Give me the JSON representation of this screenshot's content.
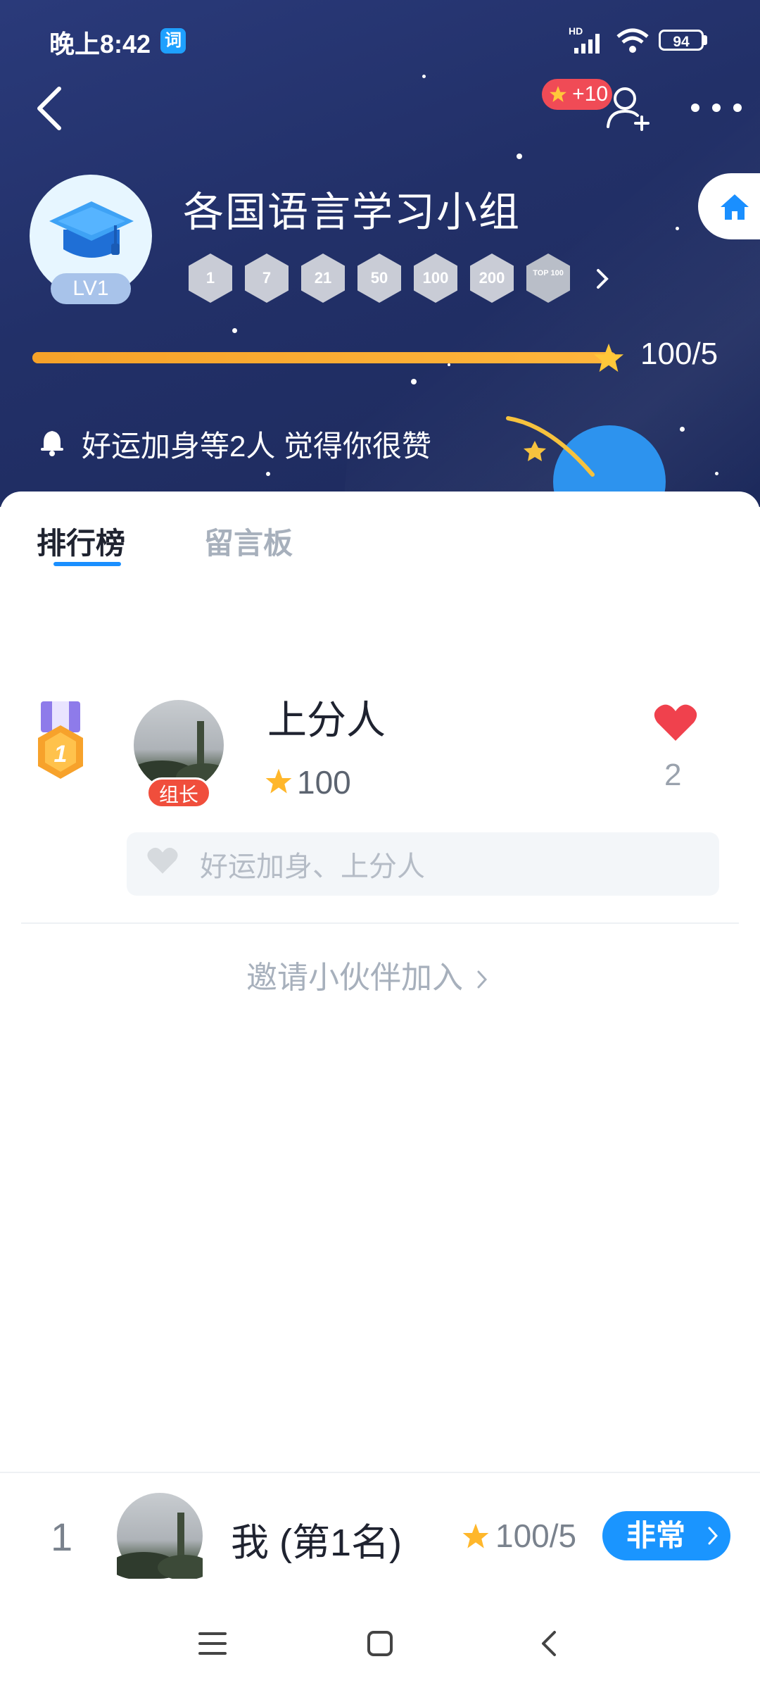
{
  "status_bar": {
    "time": "晚上8:42",
    "app_badge": "词",
    "network": "HD",
    "battery": "94"
  },
  "header": {
    "points_badge": "+10",
    "group_name": "各国语言学习小组",
    "level": "LV1",
    "badges": [
      "1",
      "7",
      "21",
      "50",
      "100",
      "200"
    ],
    "top_badge": "TOP 100",
    "progress": {
      "value": 100,
      "target": 5,
      "text": "100/5"
    },
    "likes_text": "好运加身等2人 觉得你很赞",
    "colors": {
      "background": "#223068",
      "progress": "#f6a229",
      "accent": "#1a8fff"
    }
  },
  "tabs": [
    {
      "label": "排行榜",
      "active": true
    },
    {
      "label": "留言板",
      "active": false
    }
  ],
  "leaderboard": [
    {
      "rank": "1",
      "name": "上分人",
      "role_badge": "组长",
      "score": "100",
      "likes": "2",
      "comment_placeholder": "好运加身、上分人"
    }
  ],
  "invite_text": "邀请小伙伴加入",
  "my_rank": {
    "rank": "1",
    "name": "我 (第1名)",
    "score": "100/5",
    "button_label": "非常"
  },
  "icons": [
    "back-icon",
    "add-user-icon",
    "more-icon",
    "home-icon",
    "bell-icon",
    "medal-icon",
    "heart-icon",
    "star-icon",
    "chevron-right-icon",
    "nav-menu-icon",
    "nav-home-icon",
    "nav-back-icon"
  ]
}
